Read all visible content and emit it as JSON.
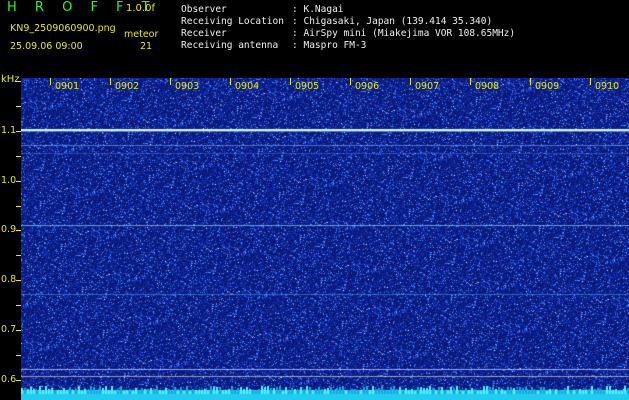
{
  "header": {
    "app_title": "H R O F F T",
    "version": "1.0.0f",
    "filename": "KN9_2509060900.png",
    "datetime": "25.09.06 09:00",
    "meteor_label": "meteor",
    "meteor_count": "21"
  },
  "metadata": [
    {
      "key": "Observer",
      "sep": ":",
      "value": "K.Nagai"
    },
    {
      "key": "Receiving Location",
      "sep": ":",
      "value": "Chigasaki, Japan (139.414 35.340)"
    },
    {
      "key": "Receiver",
      "sep": ":",
      "value": "AirSpy mini (Miakejima VOR 108.65MHz)"
    },
    {
      "key": "Receiving antenna",
      "sep": ":",
      "value": "Maspro FM-3"
    }
  ],
  "spectrogram": {
    "unit": "kHz",
    "time_labels": [
      "0901",
      "0902",
      "0903",
      "0904",
      "0905",
      "0906",
      "0907",
      "0908",
      "0909",
      "0910"
    ],
    "freq_labels": [
      "1.1",
      "1.0",
      "0.9",
      "0.8",
      "0.7",
      "0.6"
    ],
    "colors": {
      "background": "#0a1878",
      "accent": "#e8e818",
      "title": "#33ee33",
      "bottom_band": "#22ccee"
    }
  }
}
